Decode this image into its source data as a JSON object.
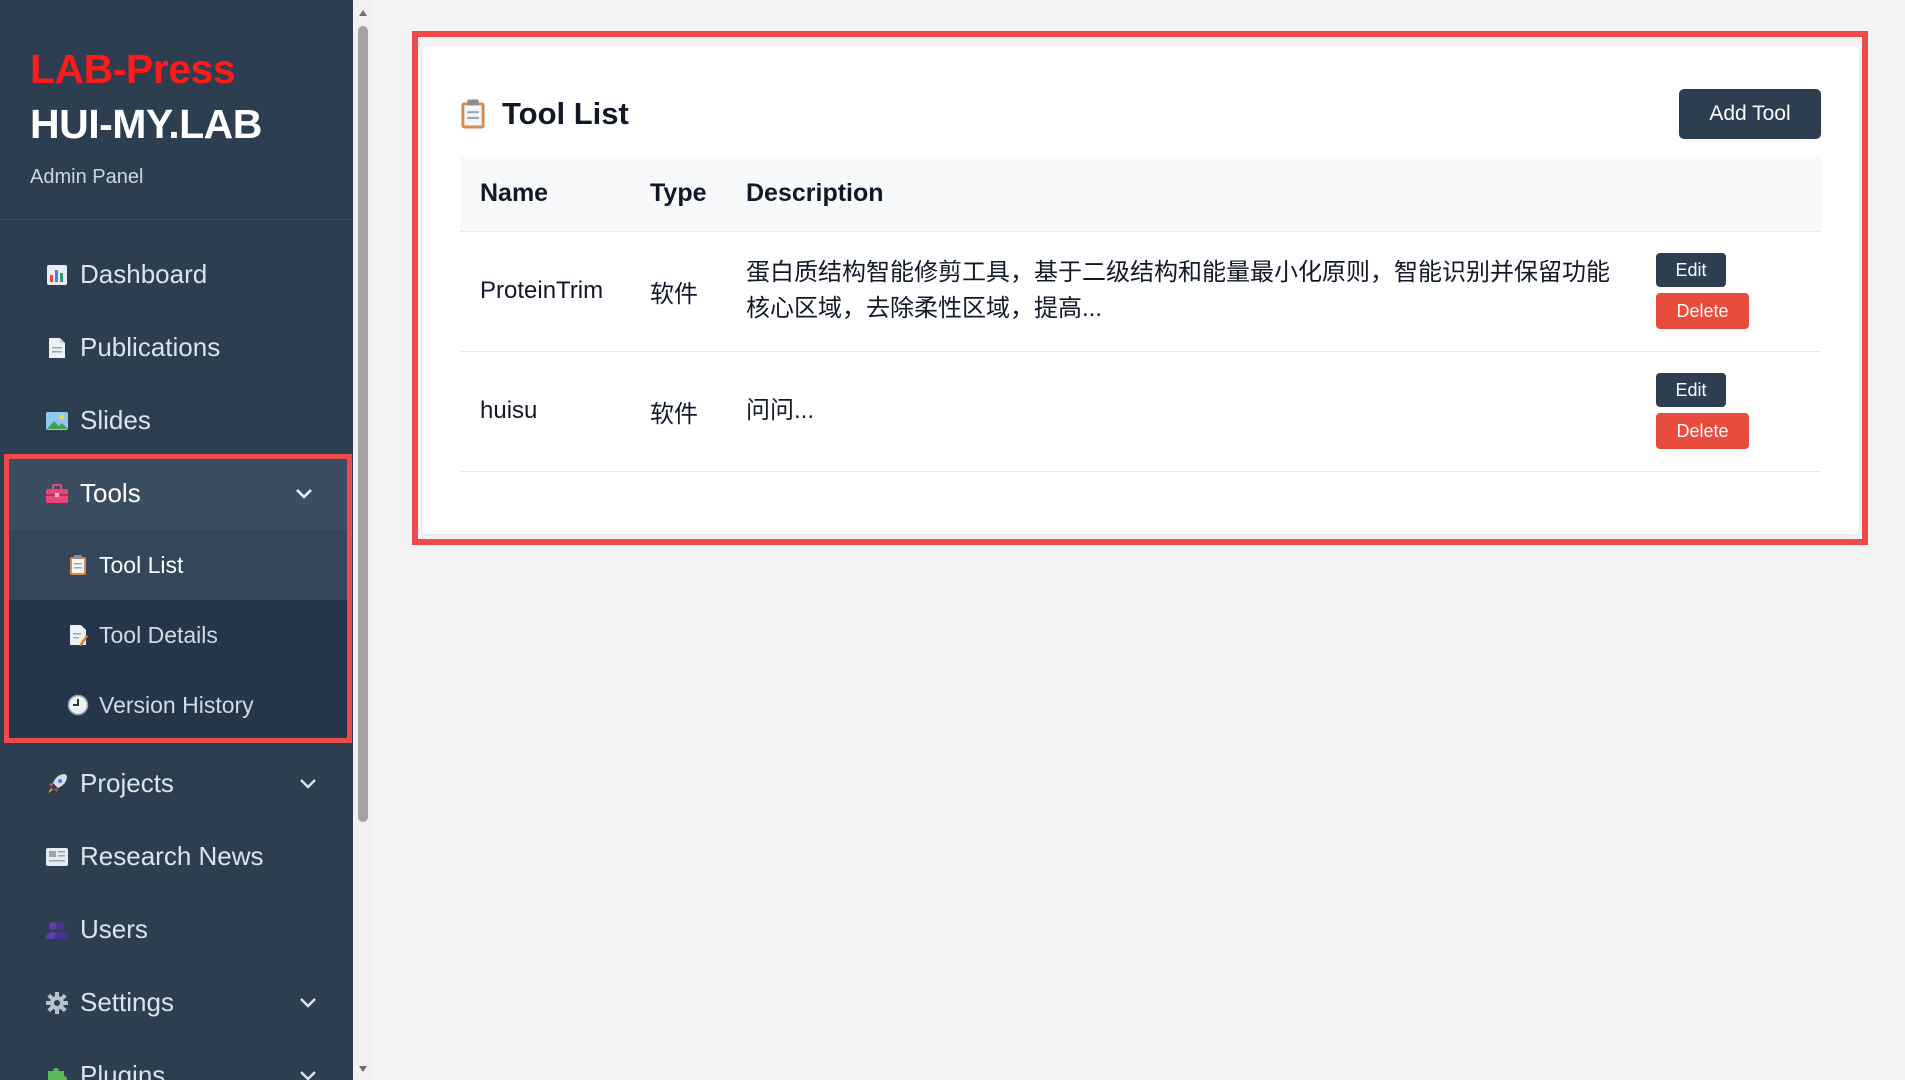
{
  "brand": {
    "line1": "LAB-Press",
    "line2": "HUI-MY.LAB",
    "subtitle": "Admin Panel",
    "accent_color": "#ff1a1a"
  },
  "sidebar": {
    "items": [
      {
        "label": "Dashboard",
        "icon": "bar-chart-icon"
      },
      {
        "label": "Publications",
        "icon": "document-icon"
      },
      {
        "label": "Slides",
        "icon": "picture-icon"
      },
      {
        "label": "Tools",
        "icon": "toolbox-icon",
        "expanded": true,
        "children": [
          {
            "label": "Tool List",
            "icon": "clipboard-icon",
            "active": true
          },
          {
            "label": "Tool Details",
            "icon": "memo-icon"
          },
          {
            "label": "Version History",
            "icon": "clock-icon"
          }
        ]
      },
      {
        "label": "Projects",
        "icon": "rocket-icon"
      },
      {
        "label": "Research News",
        "icon": "newspaper-icon"
      },
      {
        "label": "Users",
        "icon": "users-icon"
      },
      {
        "label": "Settings",
        "icon": "gear-icon"
      },
      {
        "label": "Plugins",
        "icon": "puzzle-icon"
      }
    ]
  },
  "main": {
    "title": "Tool List",
    "add_button": "Add Tool",
    "columns": [
      "Name",
      "Type",
      "Description"
    ],
    "rows": [
      {
        "name": "ProteinTrim",
        "type": "软件",
        "description": "蛋白质结构智能修剪工具，基于二级结构和能量最小化原则，智能识别并保留功能核心区域，去除柔性区域，提高..."
      },
      {
        "name": "huisu",
        "type": "软件",
        "description": "问问..."
      }
    ],
    "edit_label": "Edit",
    "delete_label": "Delete"
  },
  "colors": {
    "sidebar_bg": "#2c3e50",
    "primary_button": "#2c3e50",
    "danger_button": "#e74c3c",
    "highlight": "#ef4a4a"
  }
}
